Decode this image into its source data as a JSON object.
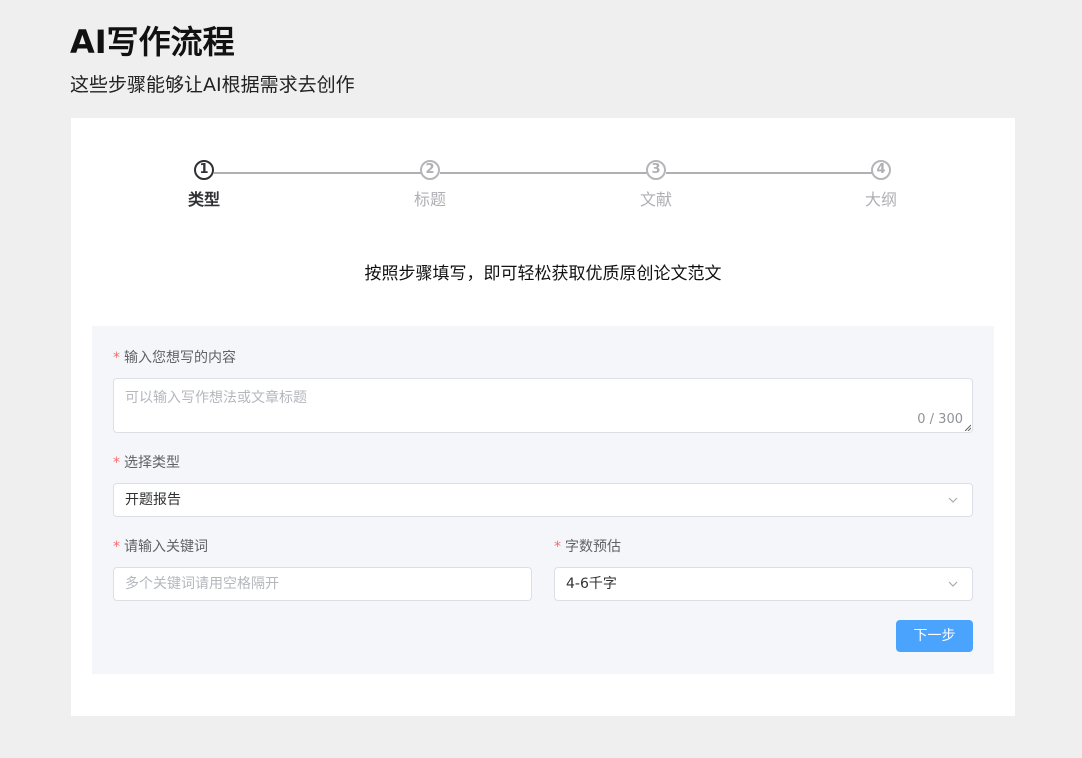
{
  "header": {
    "title": "AI写作流程",
    "subtitle": "这些步骤能够让AI根据需求去创作"
  },
  "steps": {
    "active_index": 0,
    "items": [
      {
        "number": "1",
        "label": "类型"
      },
      {
        "number": "2",
        "label": "标题"
      },
      {
        "number": "3",
        "label": "文献"
      },
      {
        "number": "4",
        "label": "大纲"
      }
    ]
  },
  "hint": "按照步骤填写，即可轻松获取优质原创论文范文",
  "form": {
    "required_mark": "*",
    "content": {
      "label": "输入您想写的内容",
      "placeholder": "可以输入写作想法或文章标题",
      "value": "",
      "count": "0 / 300"
    },
    "type": {
      "label": "选择类型",
      "value": "开题报告",
      "icon": "chevron-down-icon"
    },
    "keywords": {
      "label": "请输入关键词",
      "placeholder": "多个关键词请用空格隔开",
      "value": ""
    },
    "word_count": {
      "label": "字数预估",
      "value": "4-6千字",
      "icon": "chevron-down-icon"
    },
    "next_label": "下一步"
  },
  "colors": {
    "accent": "#4aa3fc",
    "required": "#f56c6c",
    "panel_bg": "#f5f6f9",
    "page_bg": "#efefef"
  }
}
